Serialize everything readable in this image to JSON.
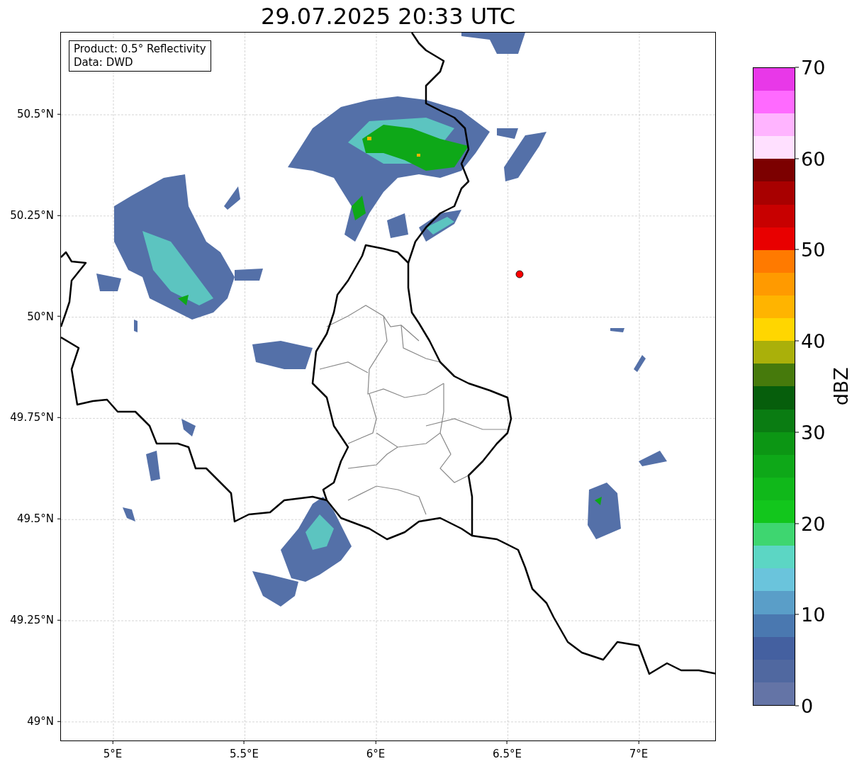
{
  "title": "29.07.2025 20:33 UTC",
  "legend": [
    "Product: 0.5° Reflectivity",
    "Data: DWD"
  ],
  "map": {
    "lat_labels": [
      "50.5°N",
      "50.25°N",
      "50°N",
      "49.75°N",
      "49.5°N",
      "49.25°N",
      "49°N"
    ],
    "lon_labels": [
      "5°E",
      "5.5°E",
      "6°E",
      "6.5°E",
      "7°E"
    ]
  },
  "colorbar": {
    "label": "dBZ",
    "ticks": [
      "70",
      "60",
      "50",
      "40",
      "30",
      "20",
      "10",
      "0"
    ],
    "bands": [
      {
        "color": "#6474a6"
      },
      {
        "color": "#5068a0"
      },
      {
        "color": "#4460a0"
      },
      {
        "color": "#4a78b0"
      },
      {
        "color": "#5a9ec8"
      },
      {
        "color": "#6ac4dc"
      },
      {
        "color": "#5cd6c4"
      },
      {
        "color": "#3ed670"
      },
      {
        "color": "#12c61c"
      },
      {
        "color": "#10b81a"
      },
      {
        "color": "#0ea818"
      },
      {
        "color": "#0c9614"
      },
      {
        "color": "#0a7c12"
      },
      {
        "color": "#065e0c"
      },
      {
        "color": "#467a0c"
      },
      {
        "color": "#aab00a"
      },
      {
        "color": "#ffd600"
      },
      {
        "color": "#ffb400"
      },
      {
        "color": "#ff9a00"
      },
      {
        "color": "#ff7a00"
      },
      {
        "color": "#e80000"
      },
      {
        "color": "#c80000"
      },
      {
        "color": "#a80000"
      },
      {
        "color": "#7c0000"
      },
      {
        "color": "#ffe0ff"
      },
      {
        "color": "#ffb4ff"
      },
      {
        "color": "#ff6aff"
      },
      {
        "color": "#e838e8"
      }
    ]
  }
}
